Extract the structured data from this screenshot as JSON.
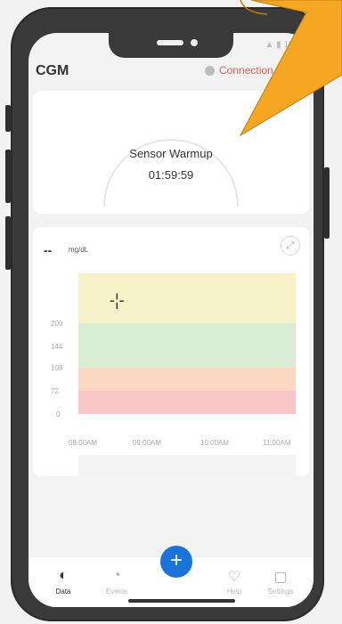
{
  "status": {
    "time": "11:..."
  },
  "header": {
    "title": "CGM",
    "connection_text": "Connection l"
  },
  "sensor": {
    "title": "Sensor Warmup",
    "time": "01:59:59"
  },
  "chart": {
    "reading": "--",
    "unit": "mg/dL",
    "y_ticks": [
      "200",
      "144",
      "108",
      "72",
      "0"
    ],
    "x_ticks": [
      "08:00AM",
      "09:00AM",
      "10:00AM",
      "11:00AM"
    ],
    "colors": {
      "high": "#f7f1c9",
      "target": "#d9ecd4",
      "low": "#fbd8c2",
      "very_low": "#f7c5c5"
    }
  },
  "tabs": [
    {
      "label": "Data",
      "icon": "drop-icon"
    },
    {
      "label": "Events",
      "icon": "events-icon"
    },
    {
      "label": "Help",
      "icon": "heart-icon"
    },
    {
      "label": "Settings",
      "icon": "settings-icon"
    }
  ],
  "fab": {
    "label": "+"
  },
  "colors": {
    "accent": "#1a73d9",
    "callout": "#f5a623",
    "warning": "#e05a5a"
  }
}
